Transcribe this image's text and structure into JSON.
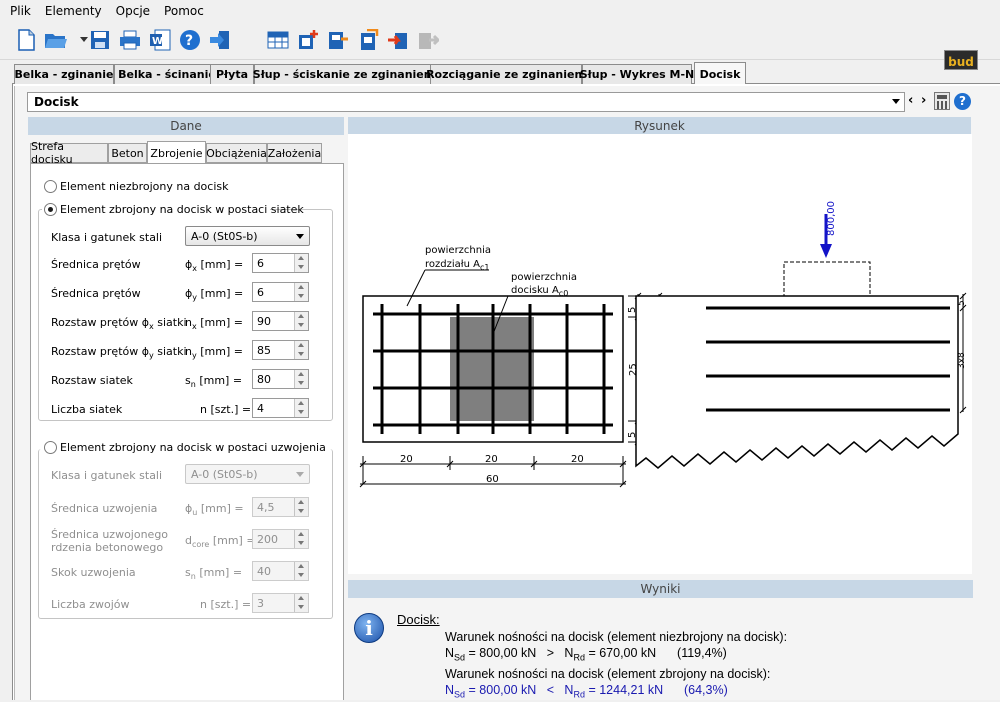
{
  "menu": [
    "Plik",
    "Elementy",
    "Opcje",
    "Pomoc"
  ],
  "toolbar": {
    "logo_text": "bud"
  },
  "tabs": [
    "Belka - zginanie",
    "Belka - ścinanie",
    "Płyta",
    "Słup - ściskanie ze zginaniem",
    "Rozciąganie ze zginaniem",
    "Słup - Wykres M-N",
    "Docisk"
  ],
  "element_selector": "Docisk",
  "sections": {
    "dane": "Dane",
    "rysunek": "Rysunek",
    "wyniki": "Wyniki"
  },
  "subtabs": [
    "Strefa docisku",
    "Beton",
    "Zbrojenie",
    "Obciążenia",
    "Założenia"
  ],
  "options": {
    "unreinforced": "Element niezbrojony na docisk",
    "mesh": "Element zbrojony na docisk w postaci siatek",
    "spiral": "Element zbrojony na docisk w postaci uzwojenia"
  },
  "mesh": {
    "steel_label": "Klasa i gatunek stali",
    "steel_value": "A-0 (St0S-b)",
    "rows": [
      {
        "label": "Średnica prętów",
        "sym": "ϕ",
        "sub": "x",
        "unit": "[mm] =",
        "value": "6"
      },
      {
        "label": "Średnica prętów",
        "sym": "ϕ",
        "sub": "y",
        "unit": "[mm] =",
        "value": "6"
      },
      {
        "label": "Rozstaw prętów ϕ",
        "lsub": "x",
        "lsuffix": " siatki",
        "sym": "n",
        "sub": "x",
        "unit": "[mm] =",
        "value": "90"
      },
      {
        "label": "Rozstaw prętów ϕ",
        "lsub": "y",
        "lsuffix": " siatki",
        "sym": "n",
        "sub": "y",
        "unit": "[mm] =",
        "value": "85"
      },
      {
        "label": "Rozstaw siatek",
        "sym": "s",
        "sub": "n",
        "unit": "[mm] =",
        "value": "80"
      },
      {
        "label": "Liczba siatek",
        "sym": "n",
        "sub": "",
        "unit": "[szt.] =",
        "value": "4"
      }
    ]
  },
  "spiral": {
    "steel_label": "Klasa i gatunek stali",
    "steel_value": "A-0 (St0S-b)",
    "rows": [
      {
        "label": "Średnica uzwojenia",
        "sym": "ϕ",
        "sub": "u",
        "unit": "[mm] =",
        "value": "4,5"
      },
      {
        "label": "Średnica uzwojonego",
        "label2": "rdzenia betonowego",
        "sym": "d",
        "sub": "core",
        "unit": "[mm] =",
        "value": "200"
      },
      {
        "label": "Skok uzwojenia",
        "sym": "s",
        "sub": "n",
        "unit": "[mm] =",
        "value": "40"
      },
      {
        "label": "Liczba zwojów",
        "sym": "n",
        "sub": "",
        "unit": "[szt.] =",
        "value": "3"
      }
    ]
  },
  "drawing": {
    "label_surface1": "powierzchnia",
    "label_surface2": "rozdziału A",
    "label_surface2_sub": "c1",
    "label_dock1": "powierzchnia",
    "label_dock2": "docisku A",
    "label_dock2_sub": "c0",
    "dim_bottom": [
      "20",
      "20",
      "20"
    ],
    "dim_total": "60",
    "dim_right": [
      "5",
      "25",
      "5"
    ],
    "dim_right_total": "35",
    "load_value": "800,00",
    "side_dims": [
      "5",
      "3x8"
    ],
    "colors": {
      "load": "#1414c8",
      "block": "#808080"
    }
  },
  "results": {
    "heading": "Docisk:",
    "line1": "Warunek nośności na docisk (element niezbrojony na docisk):",
    "n_sd_sym": "N",
    "n_sd_sub": "Sd",
    "line2_a": " = 800,00 kN   >   ",
    "n_rd_sym": "N",
    "n_rd_sub": "Rd",
    "line2_b": " = 670,00 kN      (119,4%)",
    "line3": "Warunek nośności na docisk (element zbrojony na docisk):",
    "line4_a": " = 800,00 kN   <   ",
    "line4_b": " = 1244,21 kN      (64,3%)"
  }
}
